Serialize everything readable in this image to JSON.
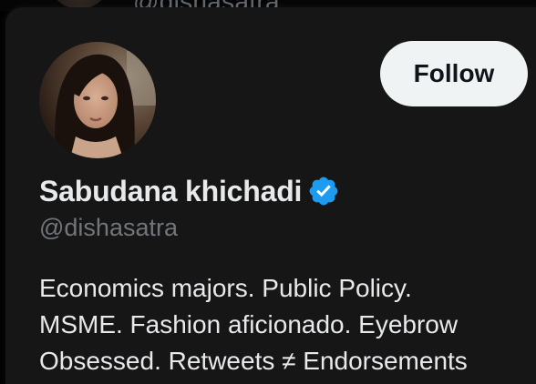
{
  "background_item": {
    "handle_partial": "@dishasatra"
  },
  "profile": {
    "display_name": "Sabudana khichadi",
    "handle": "@dishasatra",
    "verified": true,
    "bio": "Economics majors. Public Policy.\nMSME. Fashion aficionado. Eyebrow\nObsessed. Retweets ≠ Endorsements"
  },
  "actions": {
    "follow_label": "Follow"
  },
  "colors": {
    "card_background": "#161616",
    "page_background": "#000000",
    "primary_text": "#e7e9ea",
    "secondary_text": "#71767b",
    "follow_button_bg": "#eff3f4",
    "follow_button_text": "#0f1419",
    "verified_badge": "#1d9bf0"
  },
  "icons": {
    "verified": "verified-badge-icon",
    "avatar": "profile-photo"
  }
}
